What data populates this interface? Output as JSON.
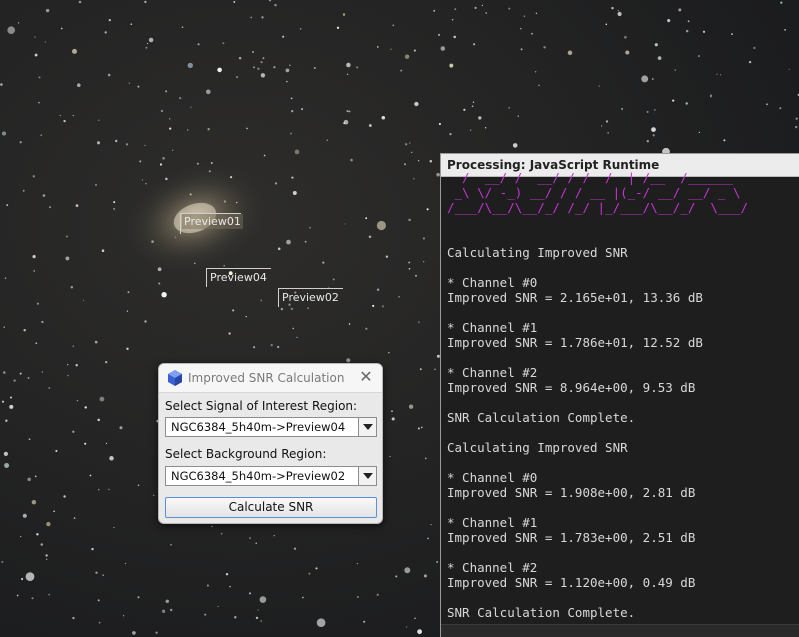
{
  "previews": [
    {
      "label": "Preview01"
    },
    {
      "label": "Preview04"
    },
    {
      "label": "Preview02"
    }
  ],
  "console": {
    "title": "Processing: JavaScript Runtime",
    "art_lines": [
      "  /  __/ /  __/ / /  /  | /__  /______",
      " _\\ \\/ -_) __/ / / __ |(_-/ __/ __/ _ \\",
      "/___/\\__/\\__/_/ /_/ |_/___/\\__/_/  \\___/"
    ],
    "lines": [
      "",
      "",
      "Calculating Improved SNR",
      "",
      "* Channel #0",
      "Improved SNR = 2.165e+01, 13.36 dB",
      "",
      "* Channel #1",
      "Improved SNR = 1.786e+01, 12.52 dB",
      "",
      "* Channel #2",
      "Improved SNR = 8.964e+00, 9.53 dB",
      "",
      "SNR Calculation Complete.",
      "",
      "Calculating Improved SNR",
      "",
      "* Channel #0",
      "Improved SNR = 1.908e+00, 2.81 dB",
      "",
      "* Channel #1",
      "Improved SNR = 1.783e+00, 2.51 dB",
      "",
      "* Channel #2",
      "Improved SNR = 1.120e+00, 0.49 dB",
      "",
      "SNR Calculation Complete."
    ],
    "art_color": "#c832d6"
  },
  "dialog": {
    "title": "Improved SNR Calculation",
    "signal_label": "Select Signal of Interest Region:",
    "signal_value": "NGC6384_5h40m->Preview04",
    "background_label": "Select Background Region:",
    "background_value": "NGC6384_5h40m->Preview02",
    "button_label": "Calculate SNR",
    "icon": "pixinsight-cube-icon",
    "close_icon": "close-icon"
  }
}
